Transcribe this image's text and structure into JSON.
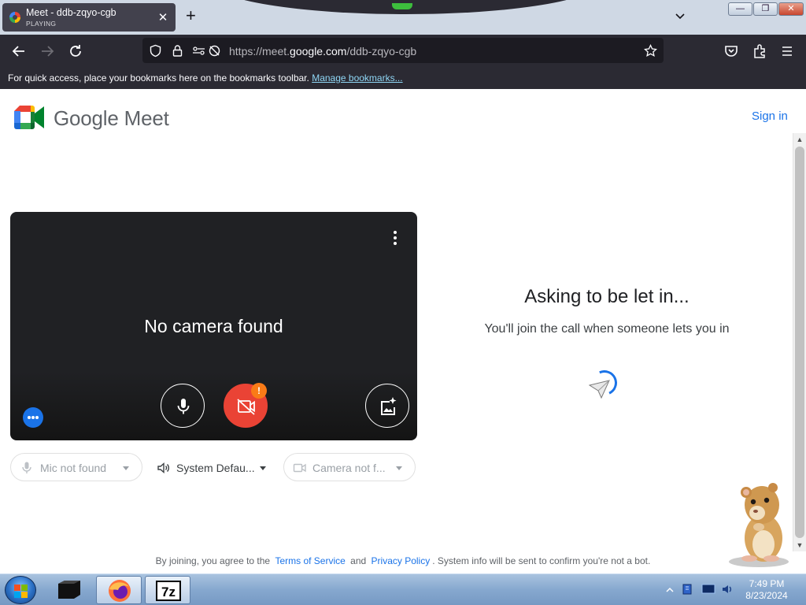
{
  "browser": {
    "tab": {
      "title": "Meet - ddb-zqyo-cgb",
      "status": "PLAYING"
    },
    "new_tab_label": "+",
    "url": {
      "prefix": "https://meet.",
      "domain": "google.com",
      "path": "/ddb-zqyo-cgb"
    },
    "bookmarks_bar": {
      "message": "For quick access, place your bookmarks here on the bookmarks toolbar.",
      "link": "Manage bookmarks..."
    }
  },
  "page": {
    "brand": "Google Meet",
    "sign_in": "Sign in",
    "preview": {
      "message": "No camera found",
      "warning_badge": "!"
    },
    "devices": {
      "mic": "Mic not found",
      "speaker": "System Defau...",
      "camera": "Camera not f..."
    },
    "status": {
      "title": "Asking to be let in...",
      "subtitle": "You'll join the call when someone lets you in"
    },
    "footer": {
      "prefix": "By joining, you agree to the",
      "terms": "Terms of Service",
      "and": "and",
      "privacy": "Privacy Policy",
      "suffix": ". System info will be sent to confirm you're not a bot."
    }
  },
  "taskbar": {
    "time": "7:49 PM",
    "date": "8/23/2024",
    "apps": [
      "terminal-icon",
      "firefox-icon",
      "7zip-icon"
    ]
  },
  "colors": {
    "accent": "#1a73e8",
    "camera_off": "#ea4335",
    "warning": "#fa7b17",
    "chrome_dark": "#2b2a33"
  }
}
